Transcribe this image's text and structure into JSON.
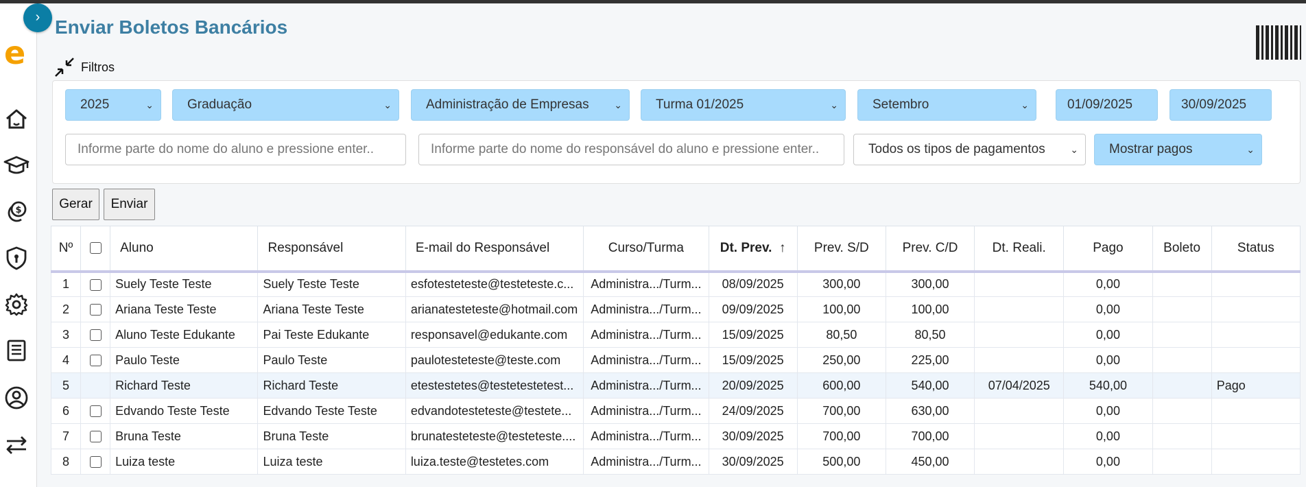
{
  "page": {
    "title": "Enviar Boletos Bancários"
  },
  "sidebar": {
    "logo": "e",
    "expand": "›",
    "items": [
      "home-icon",
      "graduation-cap-icon",
      "money-icon",
      "shield-icon",
      "gear-icon",
      "report-icon",
      "user-circle-icon",
      "transfer-icon"
    ]
  },
  "filters": {
    "label": "Filtros",
    "year": "2025",
    "level": "Graduação",
    "course": "Administração de Empresas",
    "class": "Turma 01/2025",
    "month": "Setembro",
    "date_from": "01/09/2025",
    "date_to": "30/09/2025",
    "student_placeholder": "Informe parte do nome do aluno e pressione enter..",
    "guardian_placeholder": "Informe parte do nome do responsável do aluno e pressione enter..",
    "payment_type": "Todos os tipos de pagamentos",
    "show_paid": "Mostrar pagos"
  },
  "actions": {
    "generate": "Gerar",
    "send": "Enviar"
  },
  "table": {
    "headers": [
      "Nº",
      "",
      "Aluno",
      "Responsável",
      "E-mail do Responsável",
      "Curso/Turma",
      "Dt. Prev.",
      "Prev. S/D",
      "Prev. C/D",
      "Dt. Reali.",
      "Pago",
      "Boleto",
      "Status"
    ],
    "sort_icon": "↑",
    "rows": [
      {
        "n": "1",
        "aluno": "Suely Teste Teste",
        "resp": "Suely Teste Teste",
        "email": "esfotesteteste@testeteste.c...",
        "curso": "Administra.../Turm...",
        "dtprev": "08/09/2025",
        "prevsd": "300,00",
        "prevcd": "300,00",
        "dtreal": "",
        "pago": "0,00",
        "boleto": "",
        "status": ""
      },
      {
        "n": "2",
        "aluno": "Ariana Teste Teste",
        "resp": "Ariana Teste Teste",
        "email": "arianatesteteste@hotmail.com",
        "curso": "Administra.../Turm...",
        "dtprev": "09/09/2025",
        "prevsd": "100,00",
        "prevcd": "100,00",
        "dtreal": "",
        "pago": "0,00",
        "boleto": "",
        "status": ""
      },
      {
        "n": "3",
        "aluno": "Aluno Teste Edukante",
        "resp": "Pai Teste Edukante",
        "email": "responsavel@edukante.com",
        "curso": "Administra.../Turm...",
        "dtprev": "15/09/2025",
        "prevsd": "80,50",
        "prevcd": "80,50",
        "dtreal": "",
        "pago": "0,00",
        "boleto": "",
        "status": ""
      },
      {
        "n": "4",
        "aluno": "Paulo Teste",
        "resp": "Paulo Teste",
        "email": "paulotesteteste@teste.com",
        "curso": "Administra.../Turm...",
        "dtprev": "15/09/2025",
        "prevsd": "250,00",
        "prevcd": "225,00",
        "dtreal": "",
        "pago": "0,00",
        "boleto": "",
        "status": ""
      },
      {
        "n": "5",
        "aluno": "Richard Teste",
        "resp": "Richard Teste",
        "email": "etestestetes@testetestetest...",
        "curso": "Administra.../Turm...",
        "dtprev": "20/09/2025",
        "prevsd": "600,00",
        "prevcd": "540,00",
        "dtreal": "07/04/2025",
        "pago": "540,00",
        "boleto": "",
        "status": "Pago"
      },
      {
        "n": "6",
        "aluno": "Edvando Teste Teste",
        "resp": "Edvando Teste Teste",
        "email": "edvandotesteteste@testete...",
        "curso": "Administra.../Turm...",
        "dtprev": "24/09/2025",
        "prevsd": "700,00",
        "prevcd": "630,00",
        "dtreal": "",
        "pago": "0,00",
        "boleto": "",
        "status": ""
      },
      {
        "n": "7",
        "aluno": "Bruna Teste",
        "resp": "Bruna Teste",
        "email": "brunatesteteste@testeteste....",
        "curso": "Administra.../Turm...",
        "dtprev": "30/09/2025",
        "prevsd": "700,00",
        "prevcd": "700,00",
        "dtreal": "",
        "pago": "0,00",
        "boleto": "",
        "status": ""
      },
      {
        "n": "8",
        "aluno": "Luiza teste",
        "resp": "Luiza teste",
        "email": "luiza.teste@testetes.com",
        "curso": "Administra.../Turm...",
        "dtprev": "30/09/2025",
        "prevsd": "500,00",
        "prevcd": "450,00",
        "dtreal": "",
        "pago": "0,00",
        "boleto": "",
        "status": ""
      }
    ]
  }
}
